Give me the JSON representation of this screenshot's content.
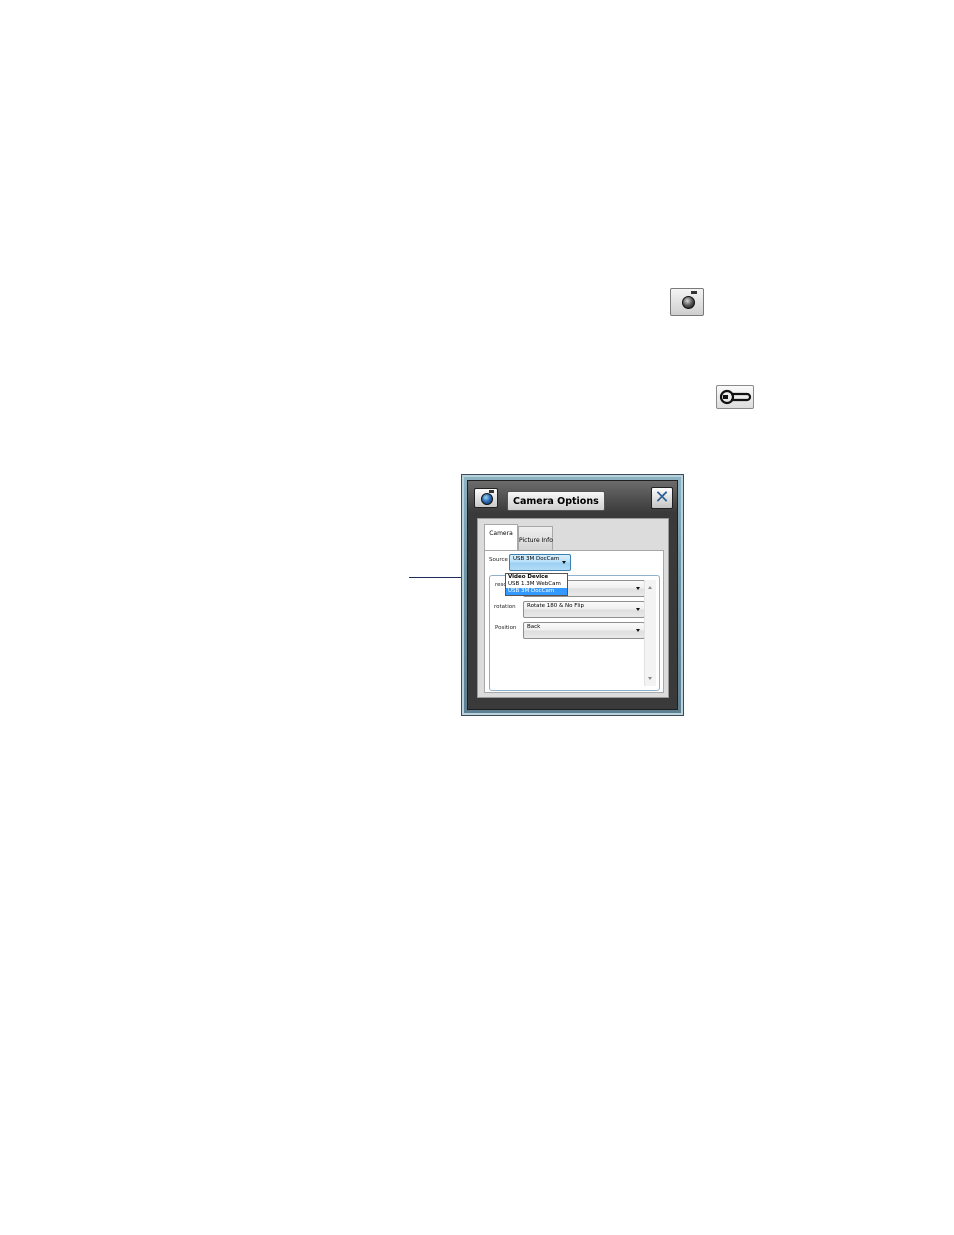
{
  "page_icons": {
    "camera_icon": "camera-icon",
    "settings_icon": "wrench-icon"
  },
  "dialog": {
    "title": "Camera Options",
    "close_glyph": "✕",
    "tabs": [
      {
        "label": "Camera",
        "active": true
      },
      {
        "label": "Picture Info",
        "active": false
      }
    ],
    "source": {
      "label": "Source",
      "value": "USB 3M DocCam"
    },
    "dropdown": {
      "header": "Video Device",
      "options": [
        {
          "label": "USB 1.3M WebCam",
          "selected": false
        },
        {
          "label": "USB 3M DocCam",
          "selected": true
        }
      ]
    },
    "fields": [
      {
        "label": "resolution",
        "visible_label": "resolu",
        "value": ""
      },
      {
        "label": "rotation",
        "value": "Rotate 180 & No Flip"
      },
      {
        "label": "Position",
        "value": "Back"
      }
    ]
  },
  "colors": {
    "selection": "#3399ff",
    "accent_blue": "#2f5f97",
    "callout_line": "#1c2d5a"
  }
}
